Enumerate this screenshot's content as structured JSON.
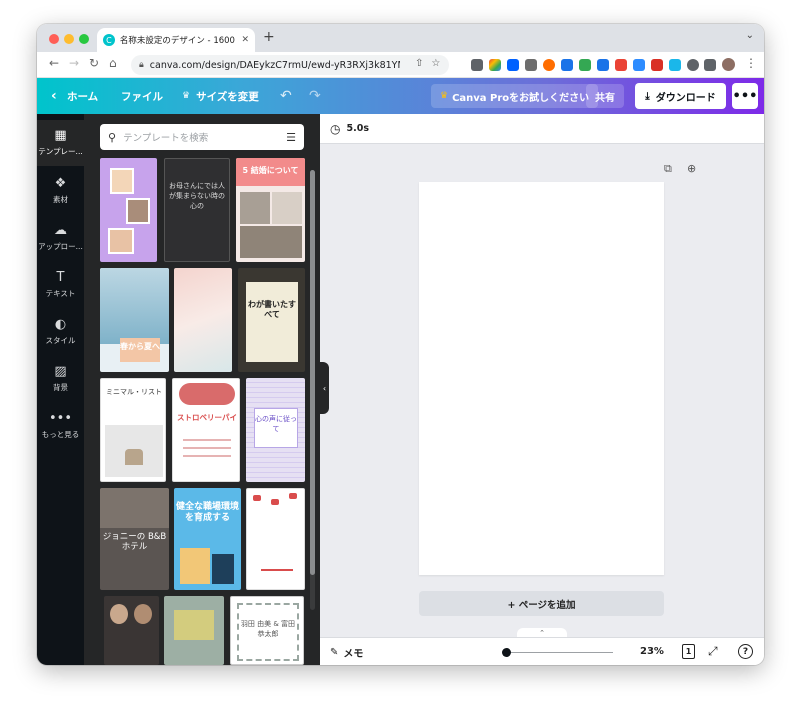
{
  "browser": {
    "tab_title": "名称未設定のデザイン - 1600 × 2...",
    "url": "canva.com/design/DAEykzC7rmU/ewd-yR3RXj3k81YMDJx0..."
  },
  "header": {
    "home": "ホーム",
    "file": "ファイル",
    "resize": "サイズを変更",
    "pro": "Canva Proをお試しください",
    "share": "共有",
    "download": "ダウンロード"
  },
  "rail": {
    "items": [
      {
        "label": "テンプレー...",
        "icon": "template-icon"
      },
      {
        "label": "素材",
        "icon": "elements-icon"
      },
      {
        "label": "アップロー...",
        "icon": "upload-icon"
      },
      {
        "label": "テキスト",
        "icon": "text-icon"
      },
      {
        "label": "スタイル",
        "icon": "style-icon"
      },
      {
        "label": "背景",
        "icon": "background-icon"
      },
      {
        "label": "もっと見る",
        "icon": "more-icon"
      }
    ]
  },
  "panel": {
    "search_placeholder": "テンプレートを検索"
  },
  "templates": {
    "t3": "5 結婚について",
    "t4": "お母さんにでは人が集まらない時の心の",
    "t5": "春から夏へ",
    "t6": "わが書いたすべて",
    "t7": "ミニマル・リスト",
    "t8": "ストロベリーパイ",
    "t9": "心の声に従って",
    "t10": "ジョニーの B&Bホテル",
    "t11": "健全な職場環境を育成する",
    "t14": "羽田 由美 & 富田 恭太郎"
  },
  "editor": {
    "duration": "5.0s",
    "add_page": "+ ページを追加",
    "memo": "メモ",
    "zoom": "23%",
    "page_count": "1"
  },
  "colors": {
    "canva_teal": "#00c4cc",
    "canva_purple": "#7d2ae8",
    "rail_bg": "#0e1318",
    "panel_bg": "#252627",
    "editor_bg": "#ebecf0"
  }
}
